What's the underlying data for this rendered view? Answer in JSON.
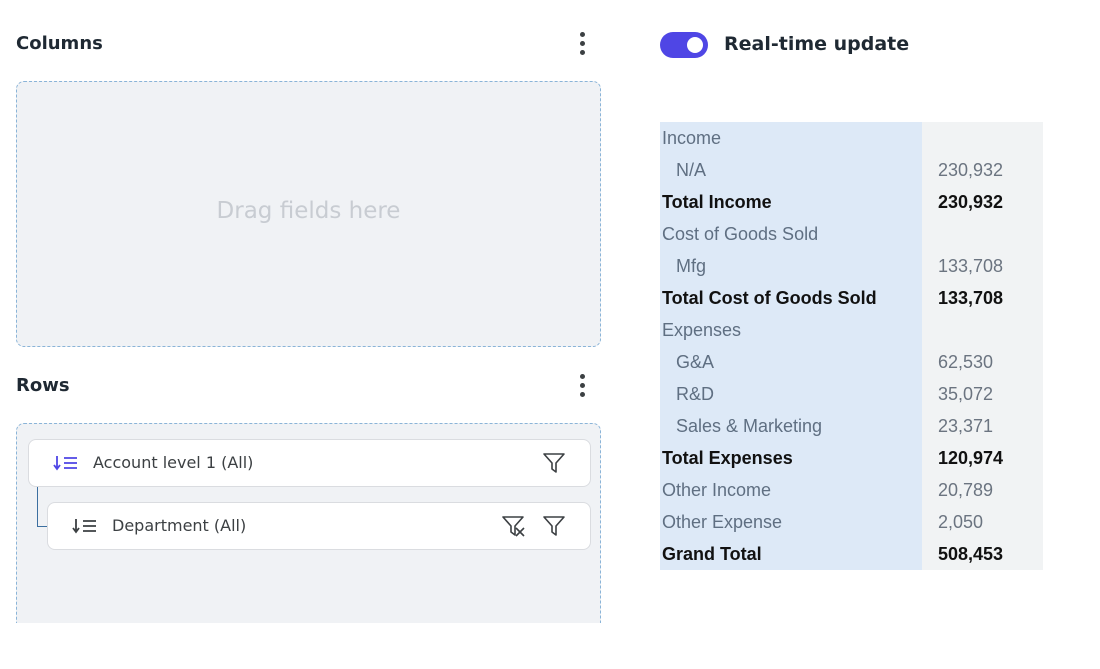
{
  "columns": {
    "title": "Columns",
    "placeholder": "Drag fields here"
  },
  "rows": {
    "title": "Rows",
    "fields": [
      {
        "label": "Account level 1 (All)"
      },
      {
        "label": "Department (All)"
      }
    ]
  },
  "realtime": {
    "label": "Real-time update",
    "enabled": true
  },
  "pivot": [
    {
      "label": "Income",
      "value": "",
      "type": "header"
    },
    {
      "label": "N/A",
      "value": "230,932",
      "type": "item"
    },
    {
      "label": "Total Income",
      "value": "230,932",
      "type": "total"
    },
    {
      "label": "Cost of Goods Sold",
      "value": "",
      "type": "header"
    },
    {
      "label": "Mfg",
      "value": "133,708",
      "type": "item"
    },
    {
      "label": "Total Cost of Goods Sold",
      "value": "133,708",
      "type": "total"
    },
    {
      "label": "Expenses",
      "value": "",
      "type": "header"
    },
    {
      "label": "G&A",
      "value": "62,530",
      "type": "item"
    },
    {
      "label": "R&D",
      "value": "35,072",
      "type": "item"
    },
    {
      "label": "Sales & Marketing",
      "value": "23,371",
      "type": "item"
    },
    {
      "label": "Total Expenses",
      "value": "120,974",
      "type": "total"
    },
    {
      "label": "Other Income",
      "value": "20,789",
      "type": "plain"
    },
    {
      "label": "Other Expense",
      "value": "2,050",
      "type": "plain"
    },
    {
      "label": "Grand Total",
      "value": "508,453",
      "type": "total"
    }
  ],
  "colors": {
    "accent": "#4f46e5",
    "row_header_bg": "#dde9f7",
    "dropzone_bg": "#f0f2f5"
  }
}
